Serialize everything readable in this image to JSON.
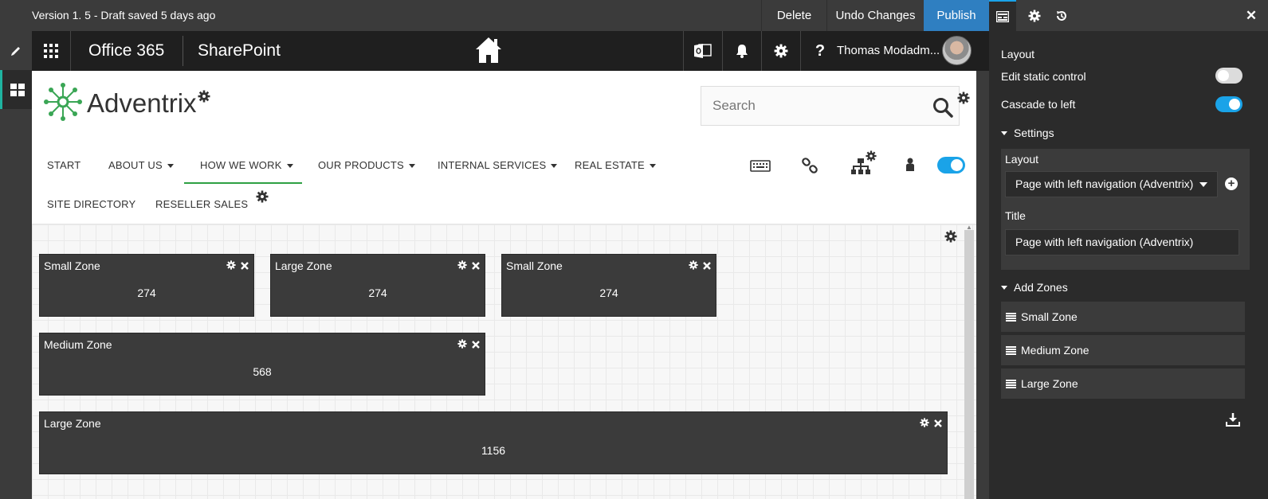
{
  "topbar": {
    "version_text": "Version 1. 5 - Draft saved 5 days ago",
    "delete_label": "Delete",
    "undo_label": "Undo Changes",
    "publish_label": "Publish",
    "close_icon": "close-icon",
    "accent_color": "#2f7fc1"
  },
  "suitebar": {
    "office_label": "Office 365",
    "sharepoint_label": "SharePoint",
    "user_name": "Thomas Modadm..."
  },
  "site": {
    "title": "Adventrix",
    "search_placeholder": "Search",
    "nav": [
      {
        "label": "START",
        "dropdown": false
      },
      {
        "label": "ABOUT US",
        "dropdown": true
      },
      {
        "label": "HOW WE WORK",
        "dropdown": true,
        "active": true
      },
      {
        "label": "OUR PRODUCTS",
        "dropdown": true
      },
      {
        "label": "INTERNAL SERVICES",
        "dropdown": true
      },
      {
        "label": "REAL ESTATE",
        "dropdown": true
      },
      {
        "label": "SITE DIRECTORY",
        "dropdown": false
      },
      {
        "label": "RESELLER SALES",
        "dropdown": false
      }
    ],
    "active_color": "#2ea043"
  },
  "zones": [
    {
      "title": "Small Zone",
      "value": "274"
    },
    {
      "title": "Large Zone",
      "value": "274"
    },
    {
      "title": "Small Zone",
      "value": "274"
    },
    {
      "title": "Medium Zone",
      "value": "568"
    },
    {
      "title": "Large Zone",
      "value": "1156"
    }
  ],
  "panel": {
    "layout_heading": "Layout",
    "edit_static_label": "Edit static control",
    "edit_static_on": false,
    "cascade_label": "Cascade to left",
    "cascade_on": true,
    "settings_heading": "Settings",
    "layout_field_label": "Layout",
    "layout_value": "Page with left navigation (Adventrix)",
    "title_field_label": "Title",
    "title_value": "Page with left navigation (Adventrix)",
    "add_zones_heading": "Add Zones",
    "add_zones": [
      "Small Zone",
      "Medium Zone",
      "Large Zone"
    ],
    "toggle_color": "#1aa3e8"
  }
}
